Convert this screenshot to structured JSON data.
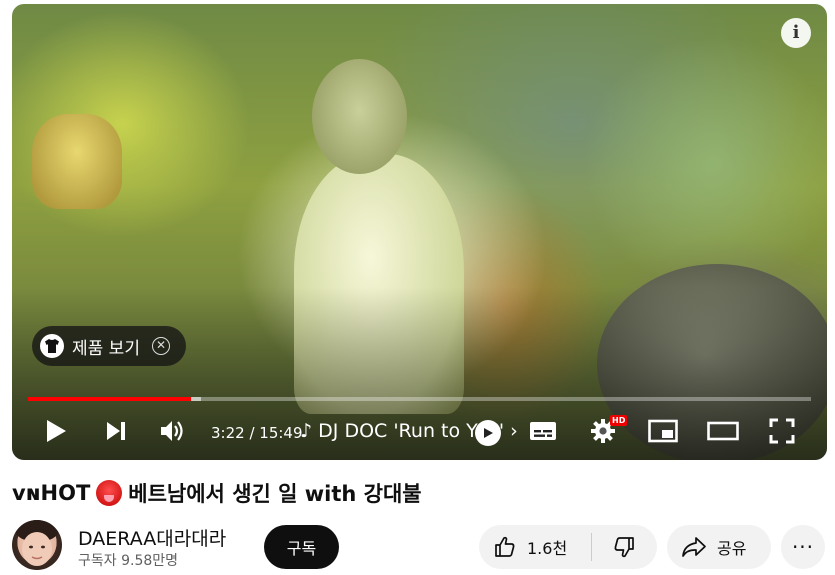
{
  "player": {
    "info_icon": "info-icon",
    "product_chip": {
      "label": "제품 보기",
      "icon": "tshirt-icon",
      "close_icon": "close-icon"
    },
    "progress": {
      "played_fraction": 0.208,
      "buffered_fraction": 0.221
    },
    "time": "3:22 / 15:49",
    "chapter": "♪ DJ DOC 'Run to You' ›",
    "controls": {
      "play_icon": "play-icon",
      "next_icon": "next-icon",
      "volume_icon": "volume-icon",
      "subtitles_icon": "subtitles-icon",
      "settings_icon": "gear-icon",
      "settings_badge": "HD",
      "miniplayer_icon": "miniplayer-icon",
      "theater_icon": "theater-icon",
      "fullscreen_icon": "fullscreen-icon"
    }
  },
  "video": {
    "title_prefix": "vɴHOT",
    "title_suffix": "베트남에서 생긴 일 with 강대불"
  },
  "channel": {
    "name": "DAERAA대라대라",
    "subscribers": "구독자 9.58만명",
    "subscribe_label": "구독"
  },
  "actions": {
    "like_count": "1.6천",
    "share_label": "공유",
    "more_label": "···"
  },
  "colors": {
    "progress": "#ff0000",
    "subscribe_bg": "#0f0f0f",
    "pill_bg": "#f2f2f2"
  }
}
